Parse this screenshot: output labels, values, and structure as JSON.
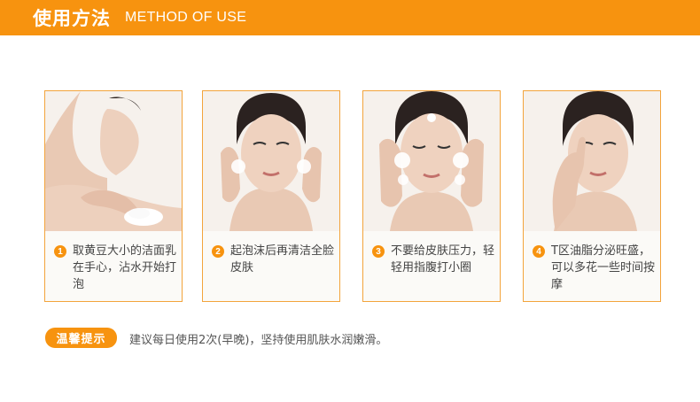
{
  "header": {
    "title_cn": "使用方法",
    "title_en": "METHOD OF USE"
  },
  "colors": {
    "accent": "#f7930f",
    "border": "#f3a43c"
  },
  "steps": [
    {
      "number": "1",
      "text": "取黄豆大小的洁面乳在手心，沾水开始打泡",
      "photo": "hand-foam-photo"
    },
    {
      "number": "2",
      "text": "起泡沫后再清洁全脸皮肤",
      "photo": "face-cleansing-photo"
    },
    {
      "number": "3",
      "text": "不要给皮肤压力，轻轻用指腹打小圈",
      "photo": "face-massage-photo"
    },
    {
      "number": "4",
      "text": "T区油脂分泌旺盛，可以多花一些时间按摩",
      "photo": "nose-massage-photo"
    }
  ],
  "tip": {
    "label": "温馨提示",
    "text": "建议每日使用2次(早晚)，坚持使用肌肤水润嫩滑。"
  }
}
